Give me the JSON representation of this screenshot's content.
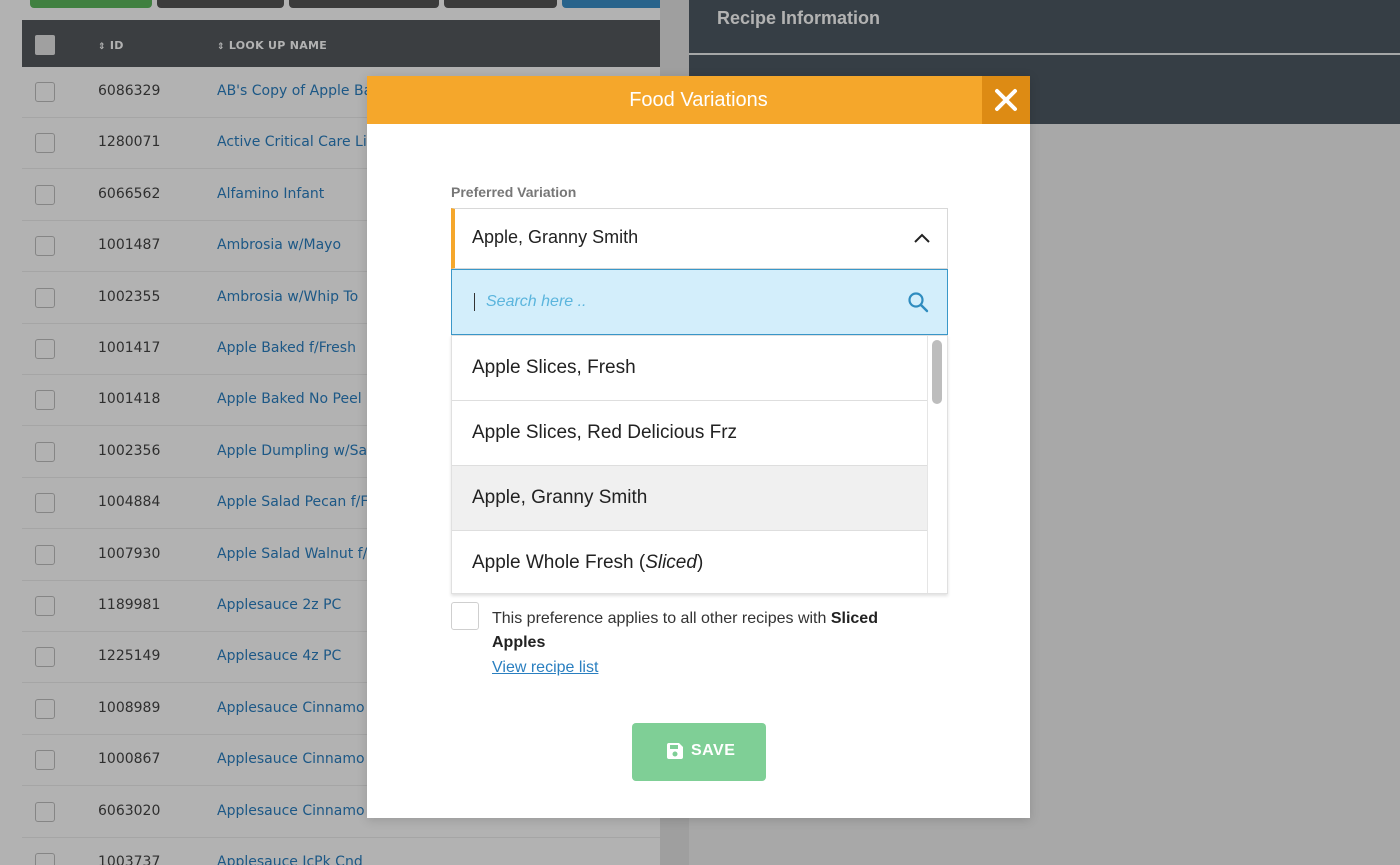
{
  "background": {
    "table": {
      "headers": {
        "id": "ID",
        "name": "LOOK UP NAME"
      },
      "rows": [
        {
          "id": "6086329",
          "name": "AB's Copy of Apple Ba"
        },
        {
          "id": "1280071",
          "name": "Active Critical Care Li"
        },
        {
          "id": "6066562",
          "name": "Alfamino Infant"
        },
        {
          "id": "1001487",
          "name": "Ambrosia w/Mayo"
        },
        {
          "id": "1002355",
          "name": "Ambrosia w/Whip To"
        },
        {
          "id": "1001417",
          "name": "Apple Baked f/Fresh"
        },
        {
          "id": "1001418",
          "name": "Apple Baked No Peel"
        },
        {
          "id": "1002356",
          "name": "Apple Dumpling w/Sa"
        },
        {
          "id": "1004884",
          "name": "Apple Salad Pecan f/F"
        },
        {
          "id": "1007930",
          "name": "Apple Salad Walnut f/"
        },
        {
          "id": "1189981",
          "name": "Applesauce 2z PC"
        },
        {
          "id": "1225149",
          "name": "Applesauce 4z PC"
        },
        {
          "id": "1008989",
          "name": "Applesauce Cinnamo"
        },
        {
          "id": "1000867",
          "name": "Applesauce Cinnamo"
        },
        {
          "id": "6063020",
          "name": "Applesauce Cinnamo"
        },
        {
          "id": "1003737",
          "name": "Applesauce IcPk Cnd"
        }
      ]
    },
    "recipe_panel": {
      "title": "Recipe Information"
    }
  },
  "modal": {
    "title": "Food Variations",
    "field_label": "Preferred Variation",
    "selected_value": "Apple, Granny Smith",
    "search": {
      "placeholder": "Search here .."
    },
    "options": [
      {
        "label": "Apple Slices, Fresh"
      },
      {
        "label": "Apple Slices, Red Delicious Frz"
      },
      {
        "label": "Apple, Granny Smith",
        "selected": true
      },
      {
        "label_main": "Apple Whole Fresh (",
        "label_italic": "Sliced",
        "label_end": ")"
      }
    ],
    "preference": {
      "text": "This preference applies to all other recipes with ",
      "bold": "Sliced Apples",
      "link": "View recipe list"
    },
    "save_label": "SAVE"
  },
  "colors": {
    "header": "#f5a72b",
    "close": "#dd8b14",
    "save": "#7fcf96",
    "link": "#2a7fc0",
    "search_bg": "#d3eefb"
  }
}
